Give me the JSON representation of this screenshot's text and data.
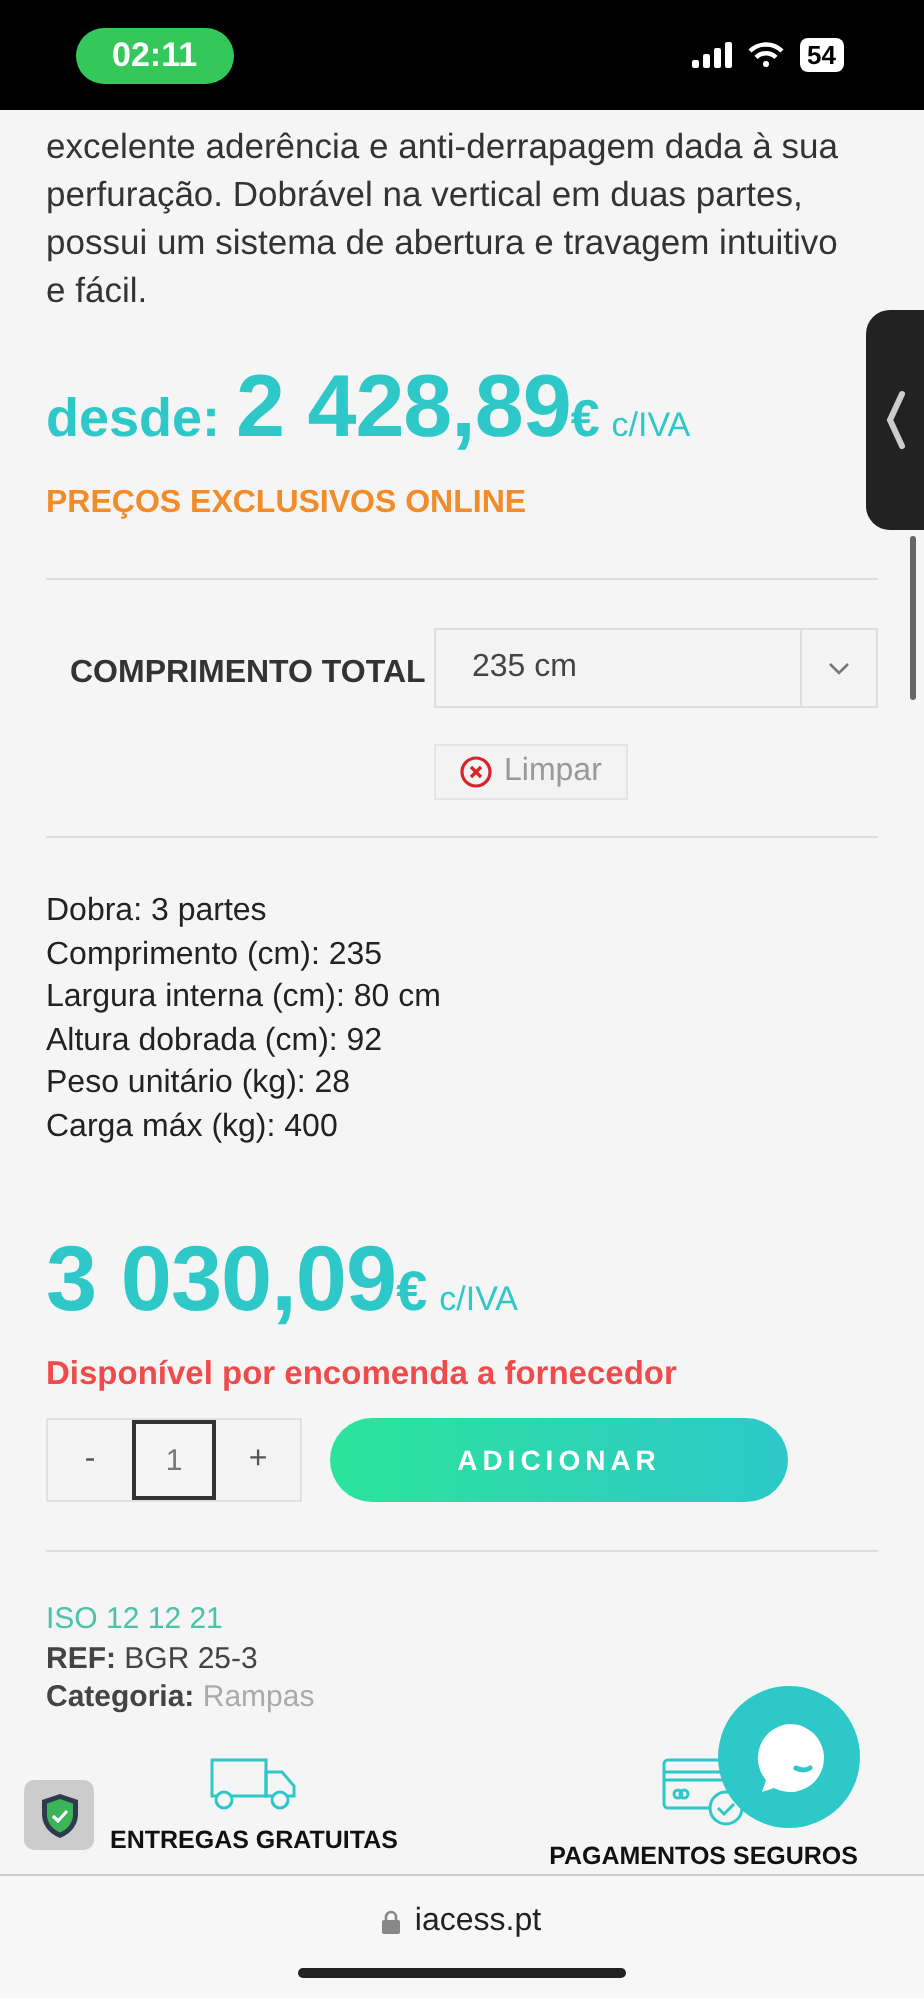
{
  "status_bar": {
    "time": "02:11",
    "battery": "54"
  },
  "description": "excelente aderência e anti-derrapagem dada à sua perfuração. Dobrável na vertical em duas partes, possui um sistema de abertura e travagem intuitivo e fácil.",
  "from_price": {
    "prefix": "desde:",
    "amount": "2 428,89",
    "currency": "€",
    "tax": "c/IVA"
  },
  "promo": "PREÇOS EXCLUSIVOS ONLINE",
  "attribute": {
    "label": "COMPRIMENTO TOTAL",
    "value": "235 cm",
    "clear": "Limpar"
  },
  "specs": [
    "Dobra: 3 partes",
    "Comprimento (cm): 235",
    "Largura interna (cm): 80 cm",
    "Altura dobrada (cm): 92",
    "Peso unitário (kg): 28",
    "Carga máx (kg): 400"
  ],
  "price": {
    "amount": "3 030,09",
    "currency": "€",
    "tax": "c/IVA"
  },
  "availability": "Disponível por encomenda a fornecedor",
  "quantity": {
    "minus": "-",
    "value": "1",
    "plus": "+"
  },
  "add_button": "ADICIONAR",
  "meta": {
    "iso": "ISO 12 12 21",
    "ref_label": "REF:",
    "ref": "BGR 25-3",
    "category_label": "Categoria:",
    "category": "Rampas"
  },
  "features": [
    {
      "kind": "truck",
      "label": "ENTREGAS GRATUITAS"
    },
    {
      "kind": "card",
      "label": "PAGAMENTOS SEGUROS"
    }
  ],
  "browser": {
    "url": "iacess.pt"
  }
}
